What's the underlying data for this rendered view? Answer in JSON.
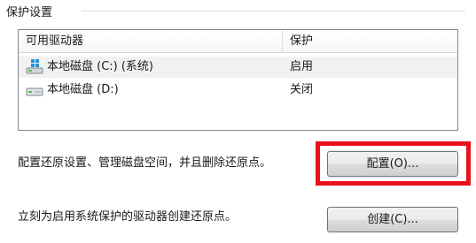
{
  "group": {
    "title": "保护设置"
  },
  "list": {
    "columns": [
      "可用驱动器",
      "保护"
    ],
    "rows": [
      {
        "name": "本地磁盘 (C:) (系统)",
        "protection": "启用",
        "icon": "system-drive-icon"
      },
      {
        "name": "本地磁盘 (D:)",
        "protection": "关闭",
        "icon": "local-drive-icon"
      }
    ]
  },
  "configure": {
    "description": "配置还原设置、管理磁盘空间，并且删除还原点。",
    "button_label": "配置(O)..."
  },
  "create": {
    "description": "立刻为启用系统保护的驱动器创建还原点。",
    "button_label": "创建(C)..."
  },
  "colors": {
    "highlight": "#e8121c",
    "selected_row": "#f1f1f1",
    "list_border": "#828790"
  }
}
